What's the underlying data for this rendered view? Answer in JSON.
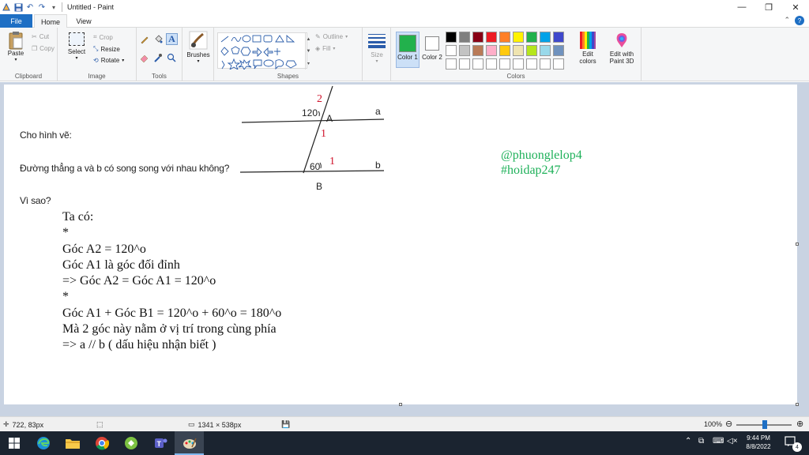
{
  "window": {
    "title": "Untitled - Paint",
    "controls": {
      "minimize": "—",
      "maximize": "❐",
      "close": "✕"
    }
  },
  "tabs": {
    "file": "File",
    "home": "Home",
    "view": "View"
  },
  "ribbon": {
    "clipboard": {
      "paste": "Paste",
      "cut": "Cut",
      "copy": "Copy",
      "label": "Clipboard"
    },
    "image": {
      "select": "Select",
      "crop": "Crop",
      "resize": "Resize",
      "rotate": "Rotate",
      "label": "Image"
    },
    "tools": {
      "label": "Tools"
    },
    "brushes": {
      "label": "Brushes"
    },
    "shapes": {
      "outline": "Outline",
      "fill": "Fill",
      "label": "Shapes"
    },
    "size": {
      "label": "Size"
    },
    "colors": {
      "color1": "Color 1",
      "color2": "Color 2",
      "edit_colors": "Edit colors",
      "edit_3d": "Edit with Paint 3D",
      "label": "Colors",
      "color1_value": "#22b14c",
      "color2_value": "#ffffff",
      "palette": [
        "#000000",
        "#7f7f7f",
        "#880015",
        "#ed1c24",
        "#ff7f27",
        "#fff200",
        "#22b14c",
        "#00a2e8",
        "#3f48cc",
        "#a349a4",
        "#ffffff",
        "#c3c3c3",
        "#b97a57",
        "#ffaec9",
        "#ffc90e",
        "#efe4b0",
        "#b5e61d",
        "#99d9ea",
        "#7092be",
        "#c8bfe7"
      ]
    }
  },
  "canvas": {
    "question": {
      "line1": "Cho hình vẽ:",
      "line2": "Đường thẳng a và b có song song với nhau không?",
      "line3": "Vì sao?"
    },
    "figure": {
      "angle_a": "120",
      "angle_b": "60",
      "point_a": "A",
      "point_b": "B",
      "line_a": "a",
      "line_b": "b",
      "red_2": "2",
      "red_1_top": "1",
      "red_1_bottom": "1"
    },
    "tags": {
      "handle": "@phuonglelop4",
      "hashtag": "#hoidap247"
    },
    "answer": [
      "Ta có:",
      "*",
      "Góc A2 = 120^o",
      "Góc A1 là góc đối đỉnh",
      "=> Góc A2 = Góc A1 = 120^o",
      "*",
      "Góc A1 + Góc B1 = 120^o + 60^o = 180^o",
      "Mà 2 góc này nằm ở vị trí trong cùng phía",
      "=> a // b ( dấu hiệu nhận biết )"
    ]
  },
  "status": {
    "cursor": "722, 83px",
    "canvas_size": "1341 × 538px",
    "zoom": "100%",
    "zoom_level": 1.0
  },
  "taskbar": {
    "time": "9:44 PM",
    "date": "8/8/2022"
  }
}
